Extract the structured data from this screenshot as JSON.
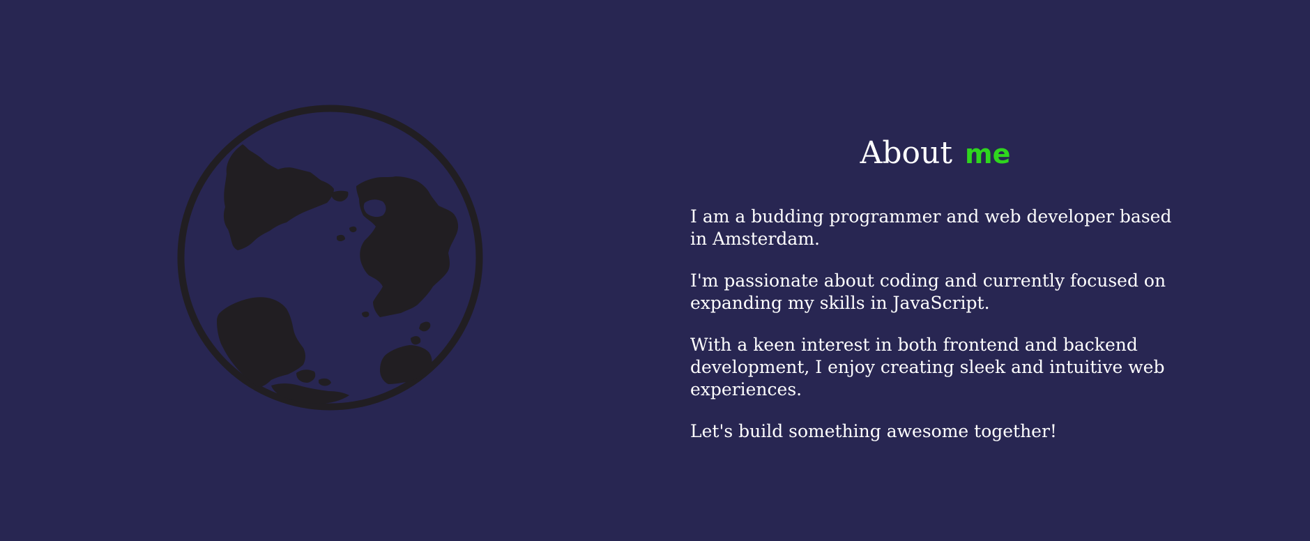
{
  "about": {
    "title_main": "About",
    "title_accent": "me",
    "paragraphs": [
      "I am a budding programmer and web developer based in Amsterdam.",
      "I'm passionate about coding and currently focused on expanding my skills in JavaScript.",
      "With a keen interest in both frontend and backend development, I enjoy creating sleek and intuitive web experiences.",
      "Let's build something awesome together!"
    ]
  },
  "colors": {
    "background": "#282652",
    "text": "#ffffff",
    "accent": "#2fd61e",
    "globe": "#211e22"
  },
  "icons": {
    "globe": "globe-icon"
  }
}
